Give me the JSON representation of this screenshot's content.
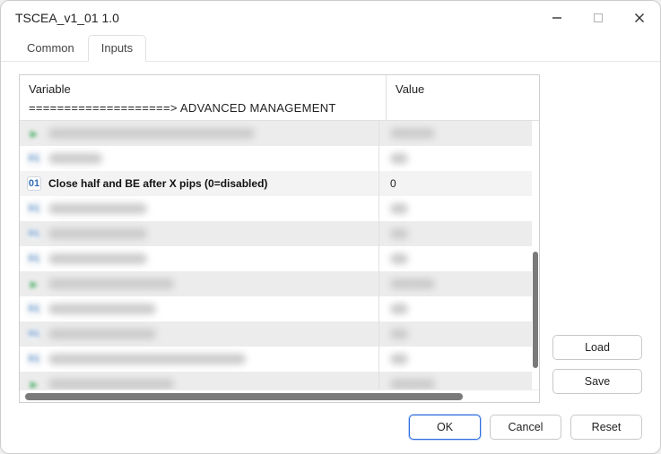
{
  "window": {
    "title": "TSCEA_v1_01 1.0"
  },
  "tabs": [
    {
      "label": "Common",
      "active": false
    },
    {
      "label": "Inputs",
      "active": true
    }
  ],
  "table": {
    "headers": {
      "variable": "Variable",
      "value": "Value"
    },
    "sectionHeading": "====================> ADVANCED MANAGEMENT",
    "rows": [
      {
        "iconType": "green",
        "icon": "▶",
        "variable": "",
        "value": "",
        "highlighted": false
      },
      {
        "iconType": "badge",
        "icon": "01",
        "variable": "",
        "value": "",
        "highlighted": false
      },
      {
        "iconType": "badge",
        "icon": "01",
        "variable": "Close half and BE after X pips (0=disabled)",
        "value": "0",
        "highlighted": true
      },
      {
        "iconType": "badge",
        "icon": "01",
        "variable": "",
        "value": "",
        "highlighted": false
      },
      {
        "iconType": "badge",
        "icon": "01",
        "variable": "",
        "value": "",
        "highlighted": false
      },
      {
        "iconType": "badge",
        "icon": "01",
        "variable": "",
        "value": "",
        "highlighted": false
      },
      {
        "iconType": "green",
        "icon": "▶",
        "variable": "",
        "value": "",
        "highlighted": false
      },
      {
        "iconType": "badge",
        "icon": "01",
        "variable": "",
        "value": "",
        "highlighted": false
      },
      {
        "iconType": "badge",
        "icon": "01",
        "variable": "",
        "value": "",
        "highlighted": false
      },
      {
        "iconType": "badge",
        "icon": "01",
        "variable": "",
        "value": "",
        "highlighted": false
      },
      {
        "iconType": "green",
        "icon": "▶",
        "variable": "",
        "value": "",
        "highlighted": false
      }
    ]
  },
  "buttons": {
    "load": "Load",
    "save": "Save",
    "ok": "OK",
    "cancel": "Cancel",
    "reset": "Reset"
  }
}
